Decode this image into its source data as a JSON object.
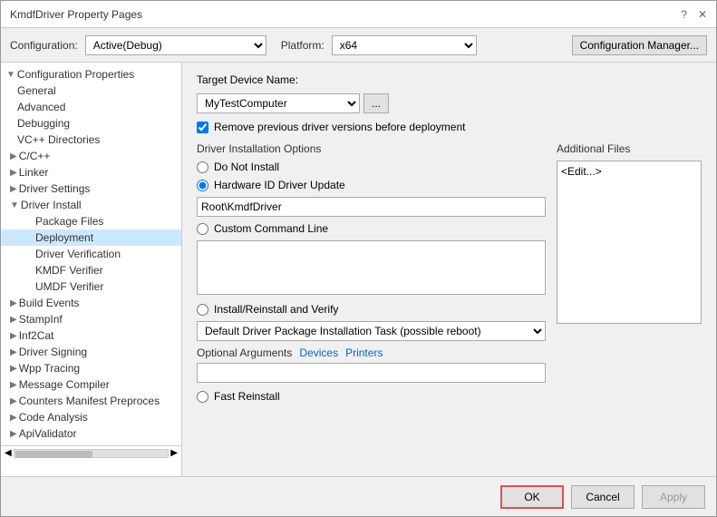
{
  "window": {
    "title": "KmdfDriver Property Pages",
    "help_icon": "?",
    "close_icon": "✕"
  },
  "toolbar": {
    "config_label": "Configuration:",
    "config_value": "Active(Debug)",
    "platform_label": "Platform:",
    "platform_value": "x64",
    "config_manager_label": "Configuration Manager..."
  },
  "sidebar": {
    "items": [
      {
        "id": "config-props",
        "label": "Configuration Properties",
        "level": 0,
        "expanded": true,
        "has_children": true
      },
      {
        "id": "general",
        "label": "General",
        "level": 1,
        "expanded": false,
        "has_children": false
      },
      {
        "id": "advanced",
        "label": "Advanced",
        "level": 1,
        "expanded": false,
        "has_children": false
      },
      {
        "id": "debugging",
        "label": "Debugging",
        "level": 1,
        "expanded": false,
        "has_children": false
      },
      {
        "id": "vc-directories",
        "label": "VC++ Directories",
        "level": 1,
        "expanded": false,
        "has_children": false
      },
      {
        "id": "cpp",
        "label": "C/C++",
        "level": 1,
        "expanded": false,
        "has_children": true
      },
      {
        "id": "linker",
        "label": "Linker",
        "level": 1,
        "expanded": false,
        "has_children": true
      },
      {
        "id": "driver-settings",
        "label": "Driver Settings",
        "level": 1,
        "expanded": false,
        "has_children": true
      },
      {
        "id": "driver-install",
        "label": "Driver Install",
        "level": 1,
        "expanded": true,
        "has_children": true
      },
      {
        "id": "package-files",
        "label": "Package Files",
        "level": 2,
        "expanded": false,
        "has_children": false
      },
      {
        "id": "deployment",
        "label": "Deployment",
        "level": 2,
        "expanded": false,
        "has_children": false,
        "selected": true
      },
      {
        "id": "driver-verification",
        "label": "Driver Verification",
        "level": 2,
        "expanded": false,
        "has_children": false
      },
      {
        "id": "kmdf-verifier",
        "label": "KMDF Verifier",
        "level": 2,
        "expanded": false,
        "has_children": false
      },
      {
        "id": "umdf-verifier",
        "label": "UMDF Verifier",
        "level": 2,
        "expanded": false,
        "has_children": false
      },
      {
        "id": "build-events",
        "label": "Build Events",
        "level": 1,
        "expanded": false,
        "has_children": true
      },
      {
        "id": "stampinf",
        "label": "StampInf",
        "level": 1,
        "expanded": false,
        "has_children": true
      },
      {
        "id": "inf2cat",
        "label": "Inf2Cat",
        "level": 1,
        "expanded": false,
        "has_children": true
      },
      {
        "id": "driver-signing",
        "label": "Driver Signing",
        "level": 1,
        "expanded": false,
        "has_children": true
      },
      {
        "id": "wpp-tracing",
        "label": "Wpp Tracing",
        "level": 1,
        "expanded": false,
        "has_children": true
      },
      {
        "id": "message-compiler",
        "label": "Message Compiler",
        "level": 1,
        "expanded": false,
        "has_children": true
      },
      {
        "id": "counters-manifest",
        "label": "Counters Manifest Preproces",
        "level": 1,
        "expanded": false,
        "has_children": true
      },
      {
        "id": "code-analysis",
        "label": "Code Analysis",
        "level": 1,
        "expanded": false,
        "has_children": true
      },
      {
        "id": "api-validator",
        "label": "ApiValidator",
        "level": 1,
        "expanded": false,
        "has_children": true
      }
    ]
  },
  "right_panel": {
    "target_device_label": "Target Device Name:",
    "target_device_value": "MyTestComputer",
    "browse_btn_label": "...",
    "remove_previous_label": "Remove previous driver versions before deployment",
    "remove_previous_checked": true,
    "driver_install_section_title": "Driver Installation Options",
    "radio_do_not_install": "Do Not Install",
    "radio_hardware_id": "Hardware ID Driver Update",
    "hardware_id_value": "Root\\KmdfDriver",
    "radio_custom_cmd": "Custom Command Line",
    "custom_cmd_placeholder": "",
    "radio_install_reinstall": "Install/Reinstall and Verify",
    "install_task_value": "Default Driver Package Installation Task (possible reboot)",
    "optional_args_label": "Optional Arguments",
    "devices_link": "Devices",
    "printers_link": "Printers",
    "optional_args_value": "",
    "radio_fast_reinstall": "Fast Reinstall",
    "additional_files_title": "Additional Files",
    "additional_files_value": "<Edit...>"
  },
  "buttons": {
    "ok_label": "OK",
    "cancel_label": "Cancel",
    "apply_label": "Apply"
  }
}
